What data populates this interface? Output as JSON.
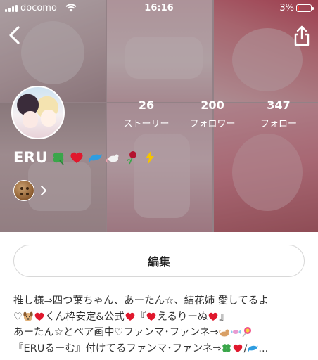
{
  "status_bar": {
    "carrier": "docomo",
    "time": "16:16",
    "battery_percent": "3%",
    "battery_level": 0.03
  },
  "profile": {
    "name": "ERU",
    "stats": [
      {
        "value": "26",
        "label": "ストーリー"
      },
      {
        "value": "200",
        "label": "フォロワー"
      },
      {
        "value": "347",
        "label": "フォロー"
      }
    ]
  },
  "edit_button": {
    "label": "編集"
  },
  "bio": {
    "line1": "推し様⇒四つ葉ちゃん、あーたん☆、結花姉 愛してるよ",
    "line2_a": "♡",
    "line2_b": "くん枠安定&公式",
    "line2_c": "『",
    "line2_d": "えるりーぬ",
    "line2_e": "』",
    "line3_a": "あーたん☆とペア画中♡ファンマ･ファンネ⇒",
    "line4_a": "『ERUるーむ』付けてるファンマ･ファンネ⇒",
    "line4_b": "/",
    "line4_c": "..."
  },
  "colors": {
    "heart": "#e0182d",
    "clover": "#3aa64a",
    "dolphin": "#2f9de0"
  }
}
